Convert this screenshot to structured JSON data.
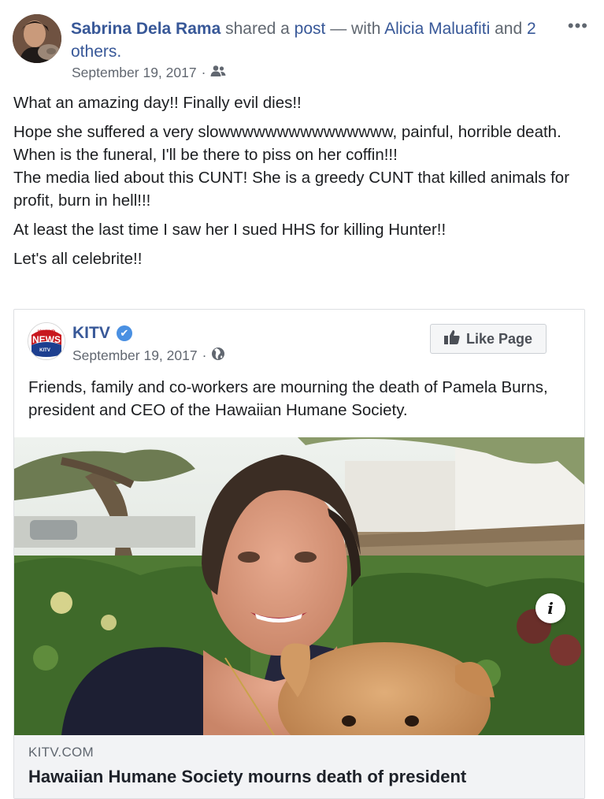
{
  "post": {
    "author": "Sabrina Dela Rama",
    "shared_text": " shared a ",
    "post_link": "post",
    "with_text": " — with ",
    "tagged_person": "Alicia Maluafiti",
    "and_text": " and ",
    "others_link": "2 others.",
    "date": "September 19, 2017",
    "meta_separator": "·",
    "audience_icon": "friends-icon",
    "more_label": "•••",
    "paragraphs": [
      "What an amazing day!! Finally evil dies!!",
      "Hope she suffered a very slowwwwwwwwwwwwwww, painful, horrible death.",
      "When is the funeral, I'll be there to piss on her coffin!!!",
      "The media lied about this CUNT! She is a greedy CUNT that killed animals for profit, burn in hell!!!",
      "At least the last time I saw her I sued HHS for killing Hunter!!",
      "Let's all celebrite!!"
    ]
  },
  "shared_post": {
    "page_name": "KITV",
    "verified_mark": "✔",
    "page_logo_text": "NEWS",
    "page_logo_sub": "KITV",
    "page_logo_top": "ISLAND",
    "date": "September 19, 2017",
    "meta_separator": "·",
    "audience_icon": "globe-icon",
    "like_button_label": "Like Page",
    "text": "Friends, family and co-workers are mourning the death of Pamela Burns, president and CEO of the Hawaiian Humane Society.",
    "link_domain": "KITV.COM",
    "link_headline": "Hawaiian Humane Society mourns death of president",
    "info_label": "i"
  },
  "colors": {
    "link_blue": "#385898",
    "meta_gray": "#606770",
    "verified_blue": "#4a90e2"
  }
}
